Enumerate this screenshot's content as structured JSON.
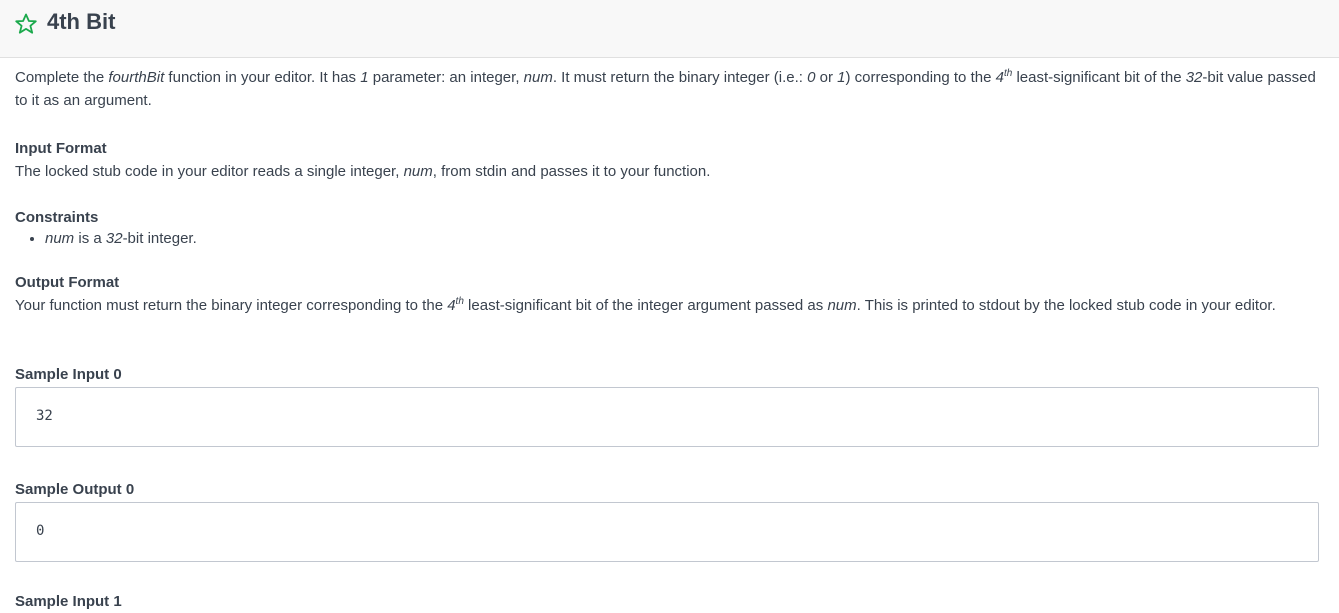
{
  "header": {
    "title": "4th Bit",
    "star_icon": "star-outline-icon",
    "accent_color": "#1ba94c"
  },
  "description": {
    "t1": "Complete the ",
    "fn": "fourthBit",
    "t2": " function in your editor. It has ",
    "one": "1",
    "t3": " parameter: an integer, ",
    "num": "num",
    "t4": ". It must return the binary integer (i.e.: ",
    "zero": "0",
    "t5": " or ",
    "one_b": "1",
    "t6": ") corresponding to the ",
    "four": "4",
    "th": "th",
    "t7": " least-significant bit of the ",
    "bits": "32",
    "t8": "-bit value passed to it as an argument."
  },
  "input_format": {
    "heading": "Input Format",
    "t1": "The locked stub code in your editor reads a single integer, ",
    "num": "num",
    "t2": ", from stdin and passes it to your function."
  },
  "constraints": {
    "heading": "Constraints",
    "num": "num",
    "t1": " is a ",
    "bits": "32",
    "t2": "-bit integer."
  },
  "output_format": {
    "heading": "Output Format",
    "t1": "Your function must return the binary integer corresponding to the ",
    "four": "4",
    "th": "th",
    "t2": " least-significant bit of the integer argument passed as ",
    "num": "num",
    "t3": ". This is printed to stdout by the locked stub code in your editor."
  },
  "sample_input_0": {
    "heading": "Sample Input 0",
    "value": "32"
  },
  "sample_output_0": {
    "heading": "Sample Output 0",
    "value": "0"
  },
  "sample_input_1": {
    "heading": "Sample Input 1"
  }
}
